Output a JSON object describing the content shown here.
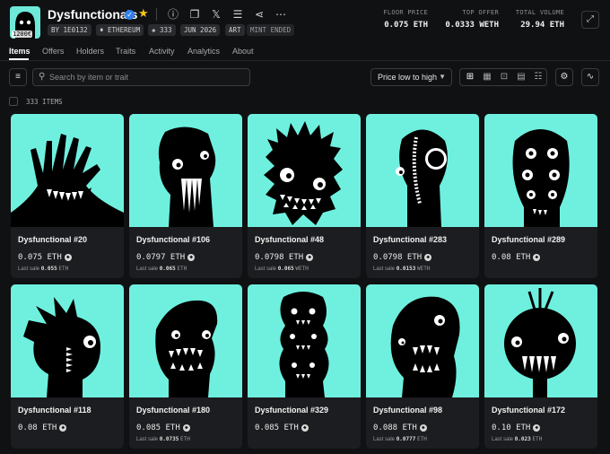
{
  "collection": {
    "name": "Dysfunctionals",
    "logo_badge": "1200€",
    "chips": [
      "BY 1E0132",
      "ETHEREUM",
      "333",
      "JUN 2026",
      "ART",
      "MINT ENDED"
    ],
    "icons": [
      "info-icon",
      "copy-icon",
      "x-icon",
      "menu-icon",
      "share-icon",
      "more-icon"
    ]
  },
  "stats": [
    {
      "label": "FLOOR PRICE",
      "value": "0.075 ETH"
    },
    {
      "label": "TOP OFFER",
      "value": "0.0333 WETH"
    },
    {
      "label": "TOTAL VOLUME",
      "value": "29.94 ETH"
    }
  ],
  "tabs": [
    "Items",
    "Offers",
    "Holders",
    "Traits",
    "Activity",
    "Analytics",
    "About"
  ],
  "toolbar": {
    "search_placeholder": "Search by item or trait",
    "sort_label": "Price low to high"
  },
  "items_count": "333 ITEMS",
  "cards": [
    {
      "name": "Dysfunctional #20",
      "price": "0.075 ETH",
      "last_prefix": "Last sale",
      "last_value": "0.055",
      "last_unit": "ETH"
    },
    {
      "name": "Dysfunctional #106",
      "price": "0.0797 ETH",
      "last_prefix": "Last sale",
      "last_value": "0.065",
      "last_unit": "ETH"
    },
    {
      "name": "Dysfunctional #48",
      "price": "0.0798 ETH",
      "last_prefix": "Last sale",
      "last_value": "0.065",
      "last_unit": "WETH"
    },
    {
      "name": "Dysfunctional #283",
      "price": "0.0798 ETH",
      "last_prefix": "Last sale",
      "last_value": "0.0153",
      "last_unit": "WETH"
    },
    {
      "name": "Dysfunctional #289",
      "price": "0.08 ETH",
      "last_prefix": "",
      "last_value": "",
      "last_unit": ""
    },
    {
      "name": "Dysfunctional #118",
      "price": "0.08 ETH",
      "last_prefix": "",
      "last_value": "",
      "last_unit": ""
    },
    {
      "name": "Dysfunctional #180",
      "price": "0.085 ETH",
      "last_prefix": "Last sale",
      "last_value": "0.0735",
      "last_unit": "ETH"
    },
    {
      "name": "Dysfunctional #329",
      "price": "0.085 ETH",
      "last_prefix": "",
      "last_value": "",
      "last_unit": ""
    },
    {
      "name": "Dysfunctional #98",
      "price": "0.088 ETH",
      "last_prefix": "Last sale",
      "last_value": "0.0777",
      "last_unit": "ETH"
    },
    {
      "name": "Dysfunctional #172",
      "price": "0.10 ETH",
      "last_prefix": "Last sale",
      "last_value": "0.023",
      "last_unit": "ETH"
    }
  ],
  "colors": {
    "accent_cyan": "#6ff0df",
    "background": "#101113",
    "card": "#1c1d20"
  }
}
